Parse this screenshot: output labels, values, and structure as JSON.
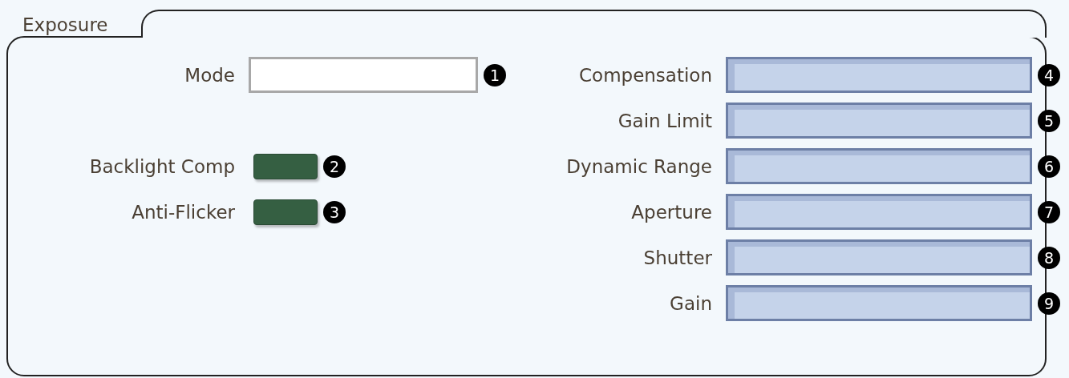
{
  "panel": {
    "title": "Exposure"
  },
  "left_rows": [
    {
      "kind": "field",
      "label": "Mode",
      "callout": "1"
    },
    {
      "kind": "toggle",
      "label": "Backlight Comp",
      "callout": "2"
    },
    {
      "kind": "toggle",
      "label": "Anti-Flicker",
      "callout": "3"
    }
  ],
  "right_rows": [
    {
      "label": "Compensation",
      "callout": "4"
    },
    {
      "label": "Gain Limit",
      "callout": "5"
    },
    {
      "label": "Dynamic Range",
      "callout": "6"
    },
    {
      "label": "Aperture",
      "callout": "7"
    },
    {
      "label": "Shutter",
      "callout": "8"
    },
    {
      "label": "Gain",
      "callout": "9"
    }
  ]
}
